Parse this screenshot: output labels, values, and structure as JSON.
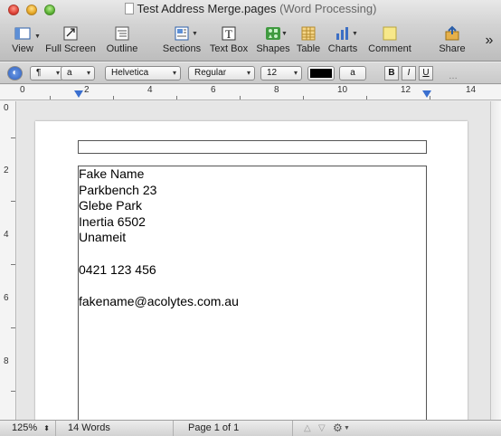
{
  "window": {
    "title": "Test Address Merge.pages",
    "subtitle": "(Word Processing)"
  },
  "toolbar": {
    "items": [
      {
        "label": "View",
        "icon": "view-icon"
      },
      {
        "label": "Full Screen",
        "icon": "fullscreen-icon"
      },
      {
        "label": "Outline",
        "icon": "outline-icon"
      },
      {
        "label": "Sections",
        "icon": "sections-icon"
      },
      {
        "label": "Text Box",
        "icon": "textbox-icon"
      },
      {
        "label": "Shapes",
        "icon": "shapes-icon"
      },
      {
        "label": "Table",
        "icon": "table-icon"
      },
      {
        "label": "Charts",
        "icon": "charts-icon"
      },
      {
        "label": "Comment",
        "icon": "comment-icon"
      },
      {
        "label": "Share",
        "icon": "share-icon"
      }
    ],
    "overflow": "»"
  },
  "formatbar": {
    "paragraph_style": "¶",
    "char_style": "a",
    "font_family": "Helvetica",
    "font_style": "Regular",
    "font_size": "12",
    "text_color": "#000000",
    "highlight_label": "a",
    "bold": "B",
    "italic": "I",
    "underline": "U"
  },
  "ruler": {
    "numbers": [
      "0",
      "2",
      "4",
      "6",
      "8",
      "10",
      "12",
      "14"
    ]
  },
  "vruler": {
    "numbers": [
      "0",
      "2",
      "4",
      "6",
      "8"
    ]
  },
  "document": {
    "address_lines": [
      "Fake Name",
      "Parkbench 23",
      "Glebe Park",
      "Inertia 6502",
      "Unameit",
      "",
      "0421 123 456",
      "",
      "fakename@acolytes.com.au"
    ]
  },
  "status": {
    "zoom": "125%",
    "word_count": "14 Words",
    "page_info": "Page 1 of 1"
  },
  "colors": {
    "accent": "#3a6fcf"
  }
}
